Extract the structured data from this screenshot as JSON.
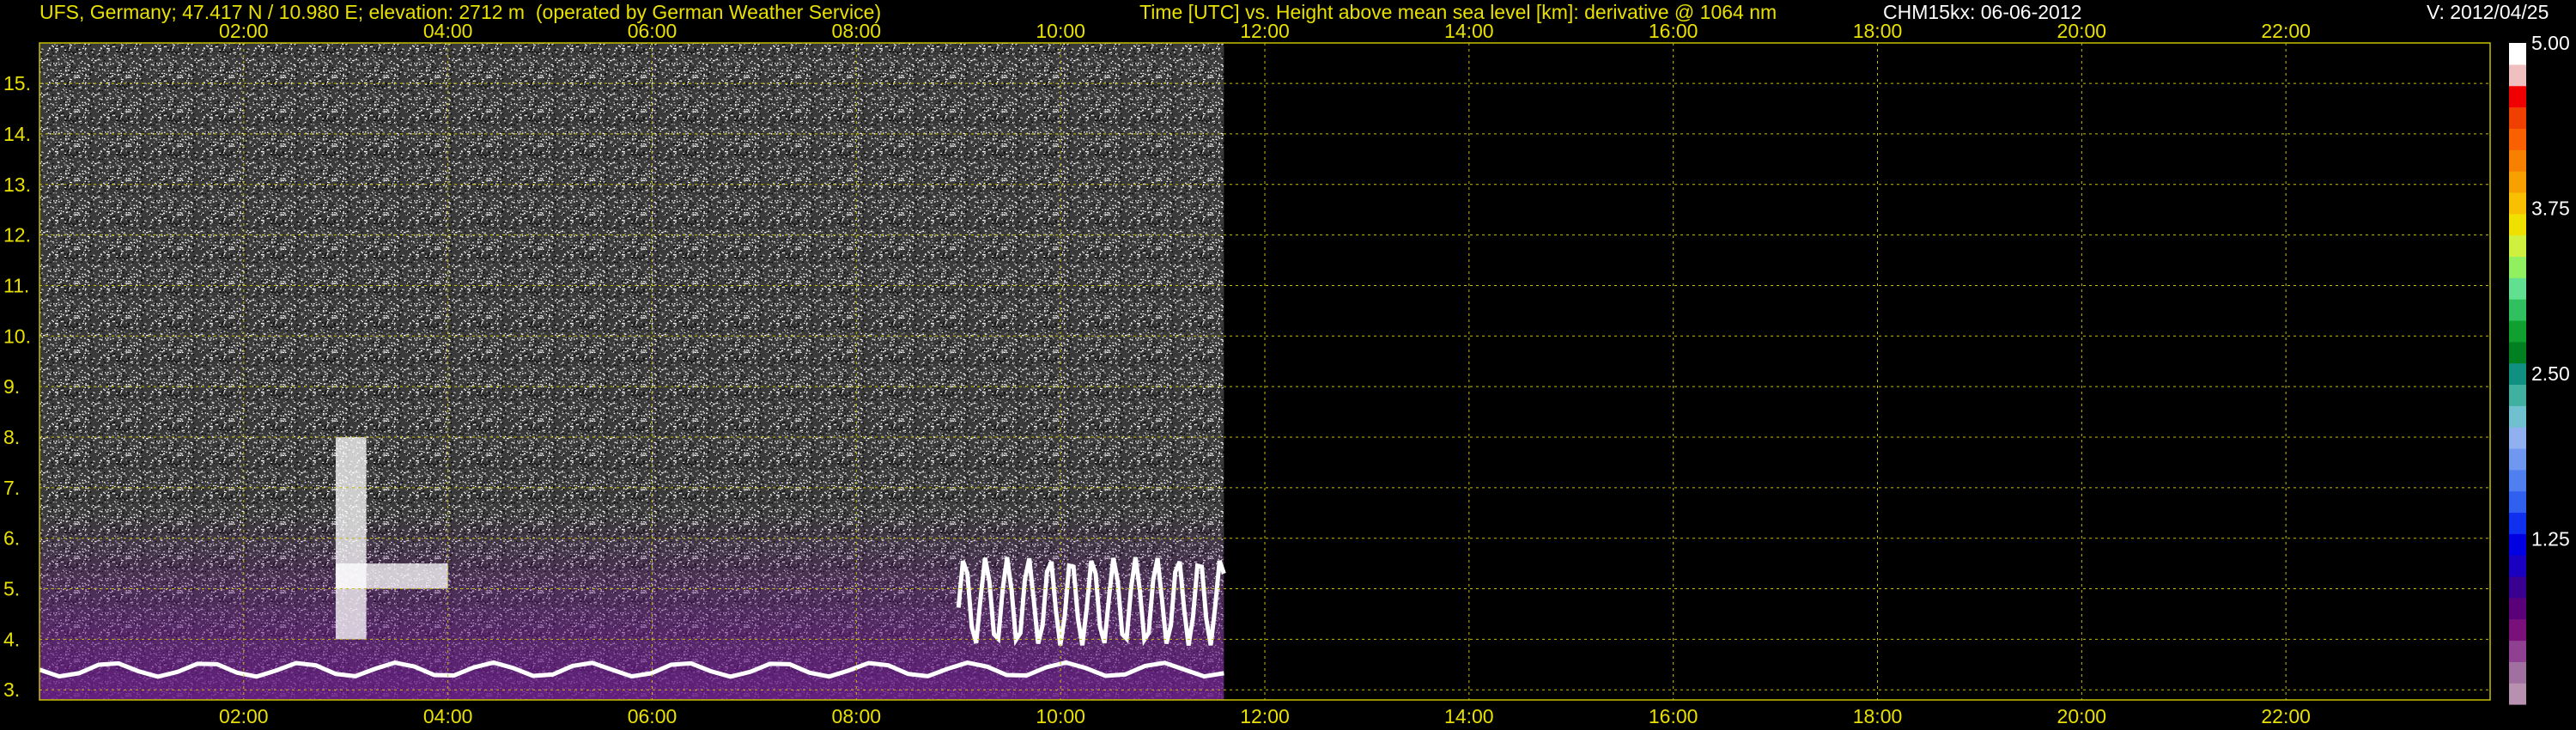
{
  "header": {
    "station": "UFS, Germany; 47.417 N / 10.980 E; elevation: 2712 m  (operated by German Weather Service)",
    "plot_title": "Time [UTC] vs. Height above mean sea level [km]: derivative @ 1064 nm",
    "instrument": "CHM15kx: 06-06-2012",
    "version": "V: 2012/04/25"
  },
  "chart_data": {
    "type": "heatmap",
    "title": "Time [UTC] vs. Height above mean sea level [km]: derivative @ 1064 nm",
    "xlabel": "Time [UTC]",
    "ylabel": "Height above mean sea level [km]",
    "x_ticks": [
      "02:00",
      "04:00",
      "06:00",
      "08:00",
      "10:00",
      "12:00",
      "14:00",
      "16:00",
      "18:00",
      "20:00",
      "22:00"
    ],
    "x_tick_values": [
      2,
      4,
      6,
      8,
      10,
      12,
      14,
      16,
      18,
      20,
      22
    ],
    "xlim": [
      0,
      24
    ],
    "y_ticks": [
      "3.",
      "4.",
      "5.",
      "6.",
      "7.",
      "8.",
      "9.",
      "10.",
      "11.",
      "12.",
      "13.",
      "14.",
      "15."
    ],
    "y_tick_values": [
      3,
      4,
      5,
      6,
      7,
      8,
      9,
      10,
      11,
      12,
      13,
      14,
      15
    ],
    "ylim": [
      2.8,
      15.8
    ],
    "data_end_time": 11.6,
    "grid": true,
    "colorbar": {
      "ticks": [
        "1.25",
        "2.50",
        "3.75",
        "5.00"
      ],
      "tick_values": [
        1.25,
        2.5,
        3.75,
        5.0
      ],
      "range": [
        0,
        5.0
      ],
      "colors": [
        "#b890b0",
        "#a070a0",
        "#904090",
        "#7a107a",
        "#5a0078",
        "#3a0090",
        "#1a00c0",
        "#0000e0",
        "#1030f0",
        "#3060f0",
        "#5080f0",
        "#7098f0",
        "#90b0f0",
        "#70c0d0",
        "#40b0a0",
        "#109080",
        "#008020",
        "#10a030",
        "#30c060",
        "#60e090",
        "#90f060",
        "#d0f040",
        "#f0e000",
        "#f8c000",
        "#f8a000",
        "#f88000",
        "#f86000",
        "#f04000",
        "#f00000",
        "#f0c0c0",
        "#ffffff"
      ]
    },
    "features": [
      {
        "name": "aerosol/boundary layer base",
        "time_range": [
          0,
          11.6
        ],
        "height_km": [
          3.2,
          3.6
        ]
      },
      {
        "name": "aerosol layer top",
        "time_range": [
          2.9,
          4.0
        ],
        "height_km": [
          5.0,
          5.5
        ]
      },
      {
        "name": "cloud edges",
        "time_range": [
          2.9,
          3.2
        ],
        "height_km": [
          4.0,
          8.0
        ]
      },
      {
        "name": "aerosol layer top",
        "time_range": [
          9.0,
          11.6
        ],
        "height_km": [
          3.5,
          6.0
        ]
      }
    ]
  },
  "colors": {
    "background": "#000000",
    "axis_text": "#e8e000",
    "grid": "#c8c000",
    "plot_border": "#c8c000",
    "noise_high": "#ffffff",
    "aerosol_purple": "#6a1a8a"
  }
}
